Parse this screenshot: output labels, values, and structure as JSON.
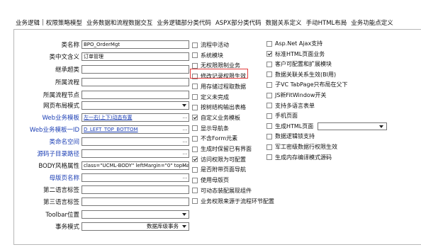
{
  "tabs": [
    "业务逻辑",
    "权限策略模型",
    "业务数据和流程数据交互",
    "业务逻辑部分类代码",
    "ASPX部分类代码",
    "数据关系定义",
    "手动HTML布局",
    "业务功能点定义"
  ],
  "form": {
    "class_name": {
      "label": "类名称",
      "value": "BPO_OrderMgt"
    },
    "cn_name": {
      "label": "类中文含义",
      "value": "订单管理"
    },
    "parent_class": {
      "label": "继承超类",
      "value": ""
    },
    "flow": {
      "label": "所属流程",
      "value": ""
    },
    "flow_node": {
      "label": "所属流程节点",
      "value": ""
    },
    "web_mode": {
      "label": "网页布局模式",
      "value": ""
    },
    "web_template": {
      "label": "Web业务模板",
      "value": "左一右(上下)动态布置"
    },
    "web_template_id": {
      "label": "Web业务模板一ID",
      "value": "D_LEFT_TOP_BOTTOM"
    },
    "namespace": {
      "label": "类命名空间",
      "value": ""
    },
    "source_dir": {
      "label": "源码子目录路径",
      "value": ""
    },
    "body_attr": {
      "label": "BODY风格属性",
      "value": "class=\"UCML-BODY\" leftMargin=\"0\" topMa"
    },
    "master_page": {
      "label": "母版页名称",
      "value": ""
    },
    "lang2": {
      "label": "第二语言标签",
      "value": ""
    },
    "lang3": {
      "label": "第三语言标签",
      "value": ""
    },
    "toolbar_pos": {
      "label": "Toolbar位置",
      "value": ""
    },
    "txn_mode": {
      "label": "事务模式",
      "value": "数据库级事务"
    }
  },
  "checks_mid": [
    {
      "label": "流程中活动",
      "checked": false
    },
    {
      "label": "系统模块",
      "checked": false
    },
    {
      "label": "无权限限制业务",
      "checked": false
    },
    {
      "label": "修改记录权限生效",
      "checked": false
    },
    {
      "label": "用存储过程取数据",
      "checked": false
    },
    {
      "label": "定义未完成",
      "checked": false
    },
    {
      "label": "按树结构输出表格",
      "checked": false
    },
    {
      "label": "自定义业务模板",
      "checked": true
    },
    {
      "label": "显示导航条",
      "checked": false
    },
    {
      "label": "不含Form元素",
      "checked": false
    },
    {
      "label": "生成时保留已有界面",
      "checked": false
    },
    {
      "label": "访问权限为可配置",
      "checked": true
    },
    {
      "label": "是否附带页面导航",
      "checked": false
    },
    {
      "label": "使用母版页",
      "checked": false
    },
    {
      "label": "可动态装配展现组件",
      "checked": false
    },
    {
      "label": "业务权限来源于流程环节配置",
      "checked": false
    }
  ],
  "checks_right": [
    {
      "label": "Asp.Net Ajax支持",
      "checked": false
    },
    {
      "label": "标准HTML页面业务",
      "checked": true
    },
    {
      "label": "客户可配置和扩展模块",
      "checked": false
    },
    {
      "label": "数据关联关系生效(BI用)",
      "checked": false
    },
    {
      "label": "子VC TabPage只布局在父下",
      "checked": false
    },
    {
      "label": "JS新FitWindow开关",
      "checked": false
    },
    {
      "label": "支持多语言表单",
      "checked": false
    },
    {
      "label": "手机页面",
      "checked": false
    },
    {
      "label": "生成HTML页面",
      "checked": false
    },
    {
      "label": "数据逻辑锁支持",
      "checked": false
    },
    {
      "label": "军工密级数据行权限生效",
      "checked": false
    },
    {
      "label": "生成内存编译模式源码",
      "checked": false
    }
  ],
  "ellipsis": "..."
}
